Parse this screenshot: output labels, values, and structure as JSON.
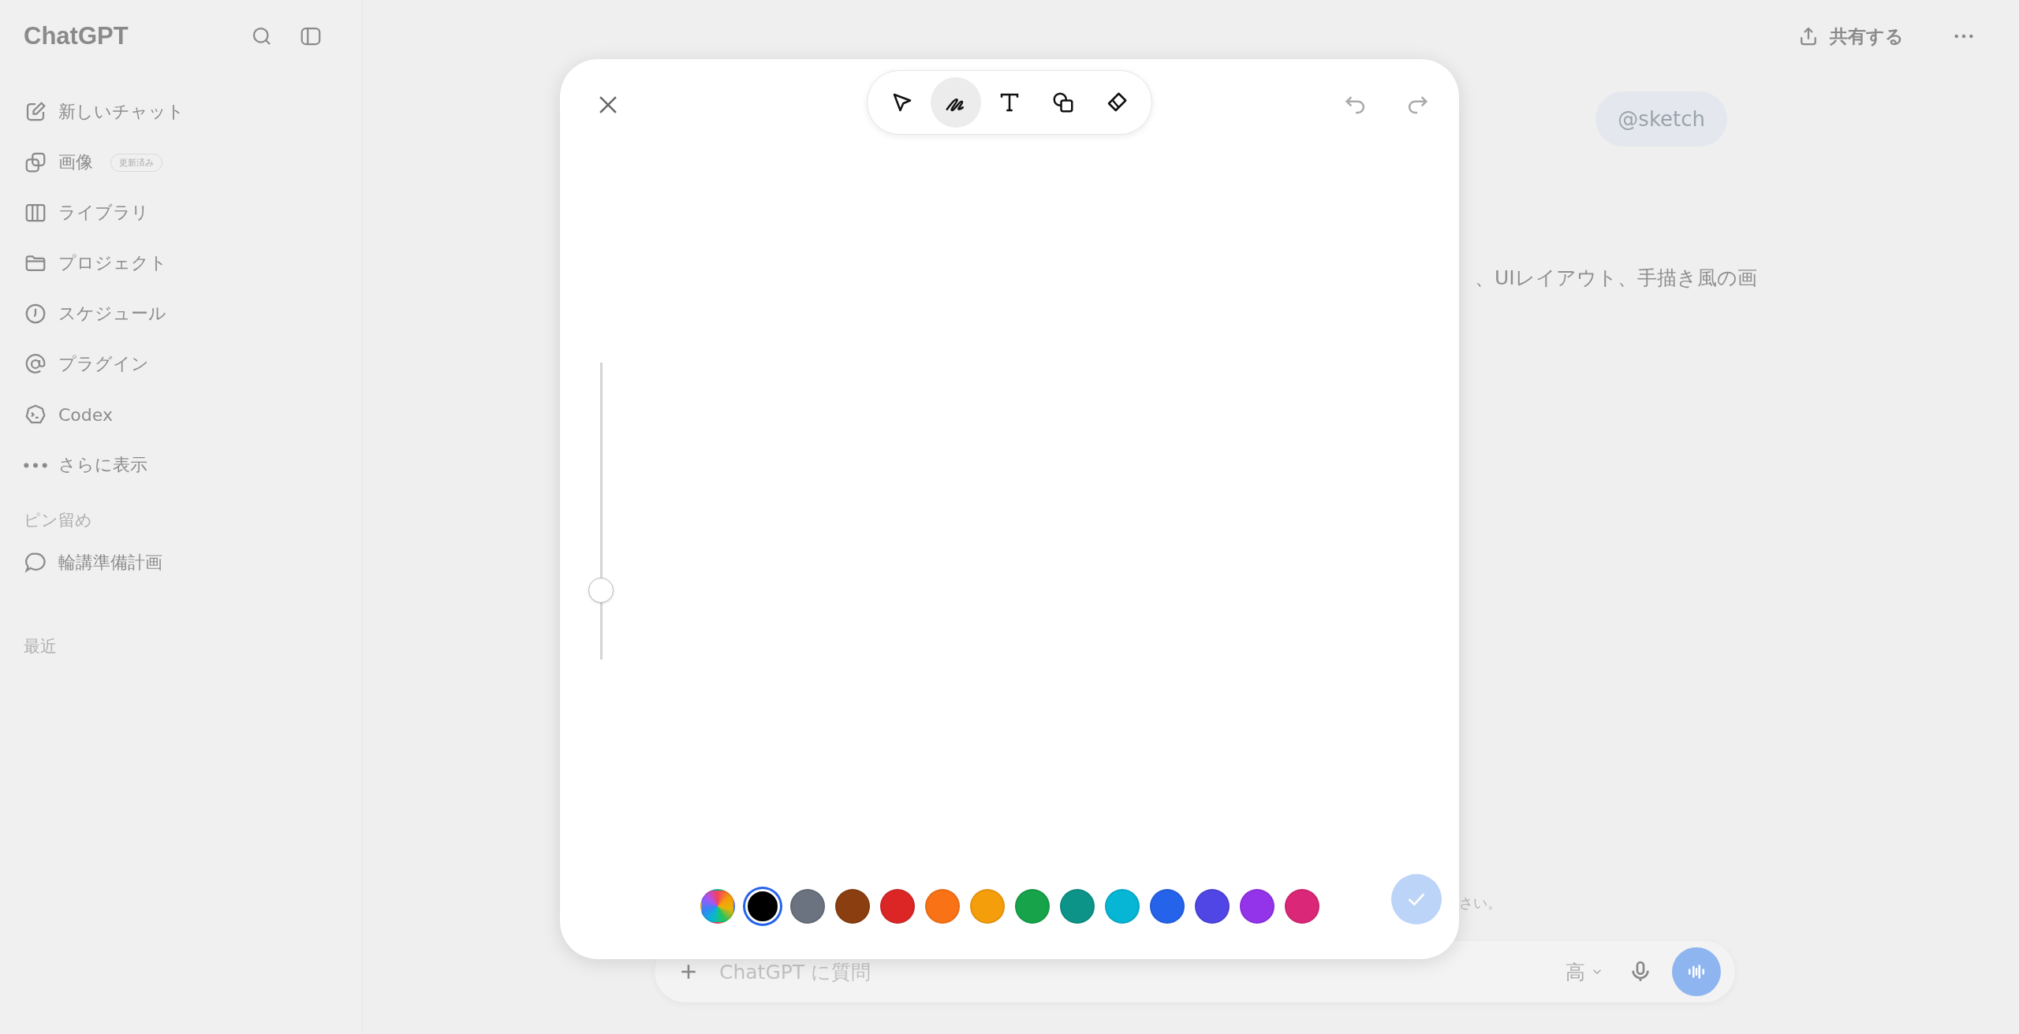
{
  "sidebar": {
    "title": "ChatGPT",
    "items": [
      {
        "kind": "edit",
        "label": "新しいチャット"
      },
      {
        "kind": "images",
        "label": "画像",
        "badge": "更新済み"
      },
      {
        "kind": "library",
        "label": "ライブラリ"
      },
      {
        "kind": "project",
        "label": "プロジェクト"
      },
      {
        "kind": "schedule",
        "label": "スケジュール"
      },
      {
        "kind": "plugin",
        "label": "プラグイン"
      },
      {
        "kind": "codex",
        "label": "Codex"
      },
      {
        "kind": "more",
        "label": "さらに表示"
      }
    ],
    "pinned": {
      "heading": "ピン留め",
      "items": [
        {
          "label": "輪講準備計画"
        }
      ]
    },
    "recent": {
      "heading": "最近"
    }
  },
  "header": {
    "share": "共有する"
  },
  "chat": {
    "user_message": "@sketch",
    "assistant_text": "、UIレイアウト、手描き風の画",
    "notice": "さい。"
  },
  "composer": {
    "placeholder": "ChatGPT に質問",
    "model": "高"
  },
  "sketch": {
    "tools": [
      {
        "kind": "select",
        "selected": false
      },
      {
        "kind": "pen",
        "selected": true
      },
      {
        "kind": "text",
        "selected": false
      },
      {
        "kind": "shapes",
        "selected": false
      },
      {
        "kind": "eraser",
        "selected": false
      }
    ],
    "size_slider": {
      "level": 0.21
    },
    "colors": [
      {
        "kind": "picker",
        "selected": false
      },
      {
        "kind": "swatch",
        "color": "#000000",
        "selected": true
      },
      {
        "kind": "swatch",
        "color": "#6b7280",
        "selected": false
      },
      {
        "kind": "swatch",
        "color": "#8b3f10",
        "selected": false
      },
      {
        "kind": "swatch",
        "color": "#dc2626",
        "selected": false
      },
      {
        "kind": "swatch",
        "color": "#f97316",
        "selected": false
      },
      {
        "kind": "swatch",
        "color": "#f59e0b",
        "selected": false
      },
      {
        "kind": "swatch",
        "color": "#16a34a",
        "selected": false
      },
      {
        "kind": "swatch",
        "color": "#0d9488",
        "selected": false
      },
      {
        "kind": "swatch",
        "color": "#06b6d4",
        "selected": false
      },
      {
        "kind": "swatch",
        "color": "#2563eb",
        "selected": false
      },
      {
        "kind": "swatch",
        "color": "#4f46e5",
        "selected": false
      },
      {
        "kind": "swatch",
        "color": "#9333ea",
        "selected": false
      },
      {
        "kind": "swatch",
        "color": "#db2777",
        "selected": false
      }
    ]
  }
}
